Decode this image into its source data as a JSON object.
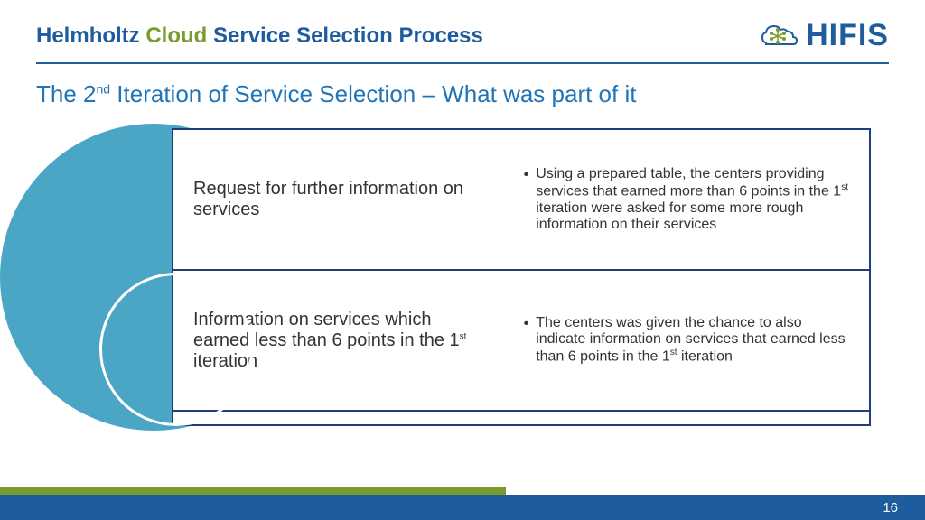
{
  "header": {
    "title_w1": "Helmholtz",
    "title_w2": "Cloud",
    "title_rest": "Service Selection Process",
    "logo_text": "HIFIS"
  },
  "subtitle": {
    "prefix": "The 2",
    "sup": "nd",
    "rest": " Iteration of Service Selection – What was part of it"
  },
  "rows": [
    {
      "left": "Request for further information on services",
      "right_pre": "Using a prepared table, the centers providing services that earned more than 6 points in the 1",
      "right_sup": "st",
      "right_post": " iteration were asked for some more rough information on their services"
    },
    {
      "left_pre": "Information on services which earned less than 6 points in the 1",
      "left_sup": "st",
      "left_post": " iteration",
      "right_pre": "The centers was given the chance to also indicate information on services that earned less than 6 points in the 1",
      "right_sup": "st",
      "right_post": " iteration"
    }
  ],
  "footer": {
    "page_number": "16"
  }
}
